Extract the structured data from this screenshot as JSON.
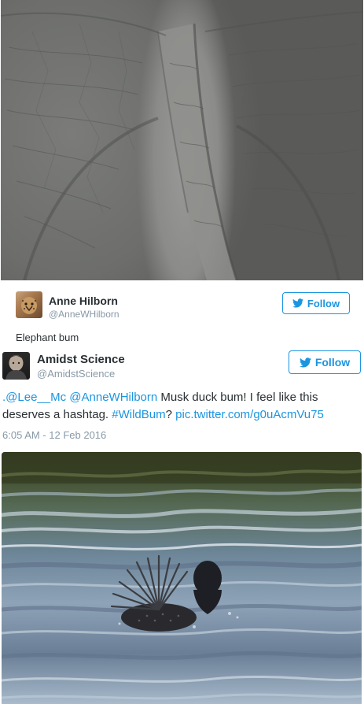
{
  "photo_top": {
    "icon": "elephant-photo"
  },
  "tweet1": {
    "name": "Anne Hilborn",
    "handle": "@AnneWHilborn",
    "follow_label": "Follow",
    "text": "Elephant bum"
  },
  "tweet2": {
    "name": "Amidst Science",
    "handle": "@AmidstScience",
    "follow_label": "Follow",
    "mention1": ".@Lee__Mc",
    "mention2": "@AnneWHilborn",
    "text_main": " Musk duck bum! I feel like this deserves a hashtag. ",
    "hashtag": "#WildBum",
    "text_q": "? ",
    "pic_link": "pic.twitter.com/g0uAcmVu75",
    "timestamp": "6:05 AM - 12 Feb 2016"
  },
  "photo_duck": {
    "icon": "musk-duck-photo"
  },
  "colors": {
    "link": "#1b95e0",
    "text": "#292f33",
    "muted": "#8899a6"
  }
}
